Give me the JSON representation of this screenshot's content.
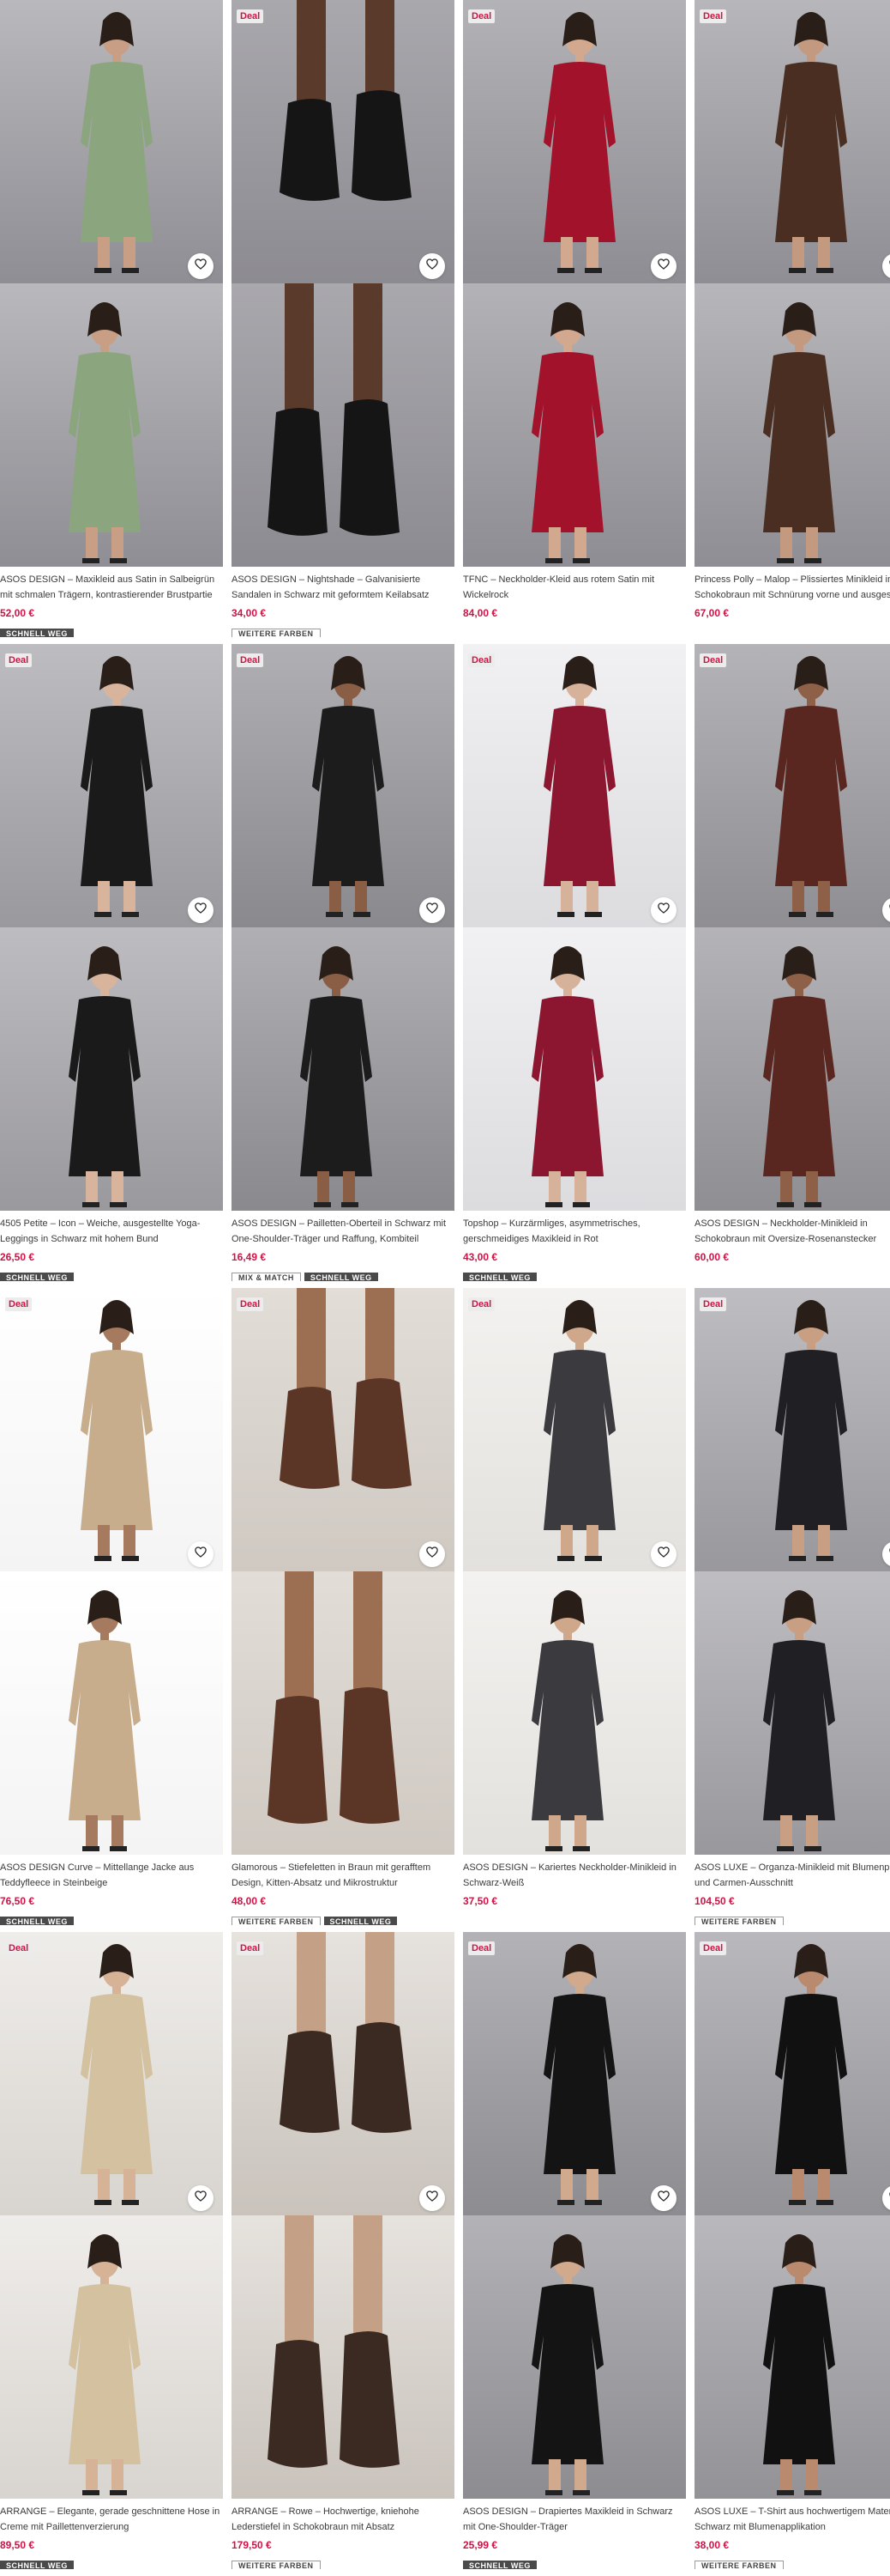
{
  "products": [
    {
      "deal": "",
      "bg": [
        "#b9b8bc",
        "#8f8e94"
      ],
      "garment": "#8ba67e",
      "skin": "#c89f84",
      "title_lines": [
        "ASOS DESIGN – Maxikleid aus Satin in Salbeigrün",
        "mit schmalen Trägern, kontrastierender Brustpartie"
      ],
      "price": "52,00 €",
      "chips": [
        {
          "label": "SCHNELL WEG",
          "style": "dark"
        }
      ]
    },
    {
      "deal": "Deal",
      "bg": [
        "#a9a8ad",
        "#8c8b91"
      ],
      "garment": "#151515",
      "skin": "#5a3a2a",
      "title_lines": [
        "ASOS DESIGN – Nightshade – Galvanisierte",
        "Sandalen in Schwarz mit geformtem Keilabsatz"
      ],
      "price": "34,00 €",
      "chips": [
        {
          "label": "WEITERE FARBEN",
          "style": "light"
        }
      ]
    },
    {
      "deal": "Deal",
      "bg": [
        "#b3b2b6",
        "#8e8d93"
      ],
      "garment": "#a3122b",
      "skin": "#d2a98f",
      "title_lines": [
        "TFNC – Neckholder-Kleid aus rotem Satin mit",
        "Wickelrock"
      ],
      "price": "84,00 €",
      "chips": []
    },
    {
      "deal": "Deal",
      "bg": [
        "#b7b6ba",
        "#8f8e94"
      ],
      "garment": "#4a2e22",
      "skin": "#c39a80",
      "title_lines": [
        "Princess Polly – Malop – Plissiertes Minikleid in",
        "Schokobraun mit Schnürung vorne und ausgest"
      ],
      "price": "67,00 €",
      "chips": []
    },
    {
      "deal": "Deal",
      "bg": [
        "#bdbcc0",
        "#9a999e"
      ],
      "garment": "#1a1a1a",
      "skin": "#d8b49c",
      "title_lines": [
        "4505 Petite – Icon – Weiche, ausgestellte Yoga-",
        "Leggings in Schwarz mit hohem Bund"
      ],
      "price": "26,50 €",
      "chips": [
        {
          "label": "SCHNELL WEG",
          "style": "dark"
        }
      ]
    },
    {
      "deal": "Deal",
      "bg": [
        "#b0afb3",
        "#8a898e"
      ],
      "garment": "#1c1c1c",
      "skin": "#8a5e45",
      "title_lines": [
        "ASOS DESIGN – Pailletten-Oberteil in Schwarz mit",
        "One-Shoulder-Träger und Raffung, Kombiteil"
      ],
      "price": "16,49 €",
      "chips": [
        {
          "label": "MIX & MATCH",
          "style": "light"
        },
        {
          "label": "SCHNELL WEG",
          "style": "dark"
        }
      ]
    },
    {
      "deal": "Deal",
      "bg": [
        "#f1f1f3",
        "#dcdcdf"
      ],
      "garment": "#8c1530",
      "skin": "#d6b29a",
      "title_lines": [
        "Topshop – Kurzärmliges, asymmetrisches,",
        "gerschmeidiges Maxikleid in Rot"
      ],
      "price": "43,00 €",
      "chips": [
        {
          "label": "SCHNELL WEG",
          "style": "dark"
        }
      ]
    },
    {
      "deal": "Deal",
      "bg": [
        "#b4b3b7",
        "#8f8e93"
      ],
      "garment": "#5a2620",
      "skin": "#8f6048",
      "title_lines": [
        "ASOS DESIGN – Neckholder-Minikleid in",
        "Schokobraun mit Oversize-Rosenanstecker"
      ],
      "price": "60,00 €",
      "chips": []
    },
    {
      "deal": "Deal",
      "bg": [
        "#ffffff",
        "#f4f4f4"
      ],
      "garment": "#c7ad8c",
      "skin": "#a57a5e",
      "title_lines": [
        "ASOS DESIGN Curve – Mittellange Jacke aus",
        "Teddyfleece in Steinbeige"
      ],
      "price": "76,50 €",
      "chips": [
        {
          "label": "SCHNELL WEG",
          "style": "dark"
        }
      ]
    },
    {
      "deal": "Deal",
      "bg": [
        "#e2ddd7",
        "#cfc9c2"
      ],
      "garment": "#5b3526",
      "skin": "#9c6f52",
      "title_lines": [
        "Glamorous – Stiefeletten in Braun mit gerafftem",
        "Design, Kitten-Absatz und Mikrostruktur"
      ],
      "price": "48,00 €",
      "chips": [
        {
          "label": "WEITERE FARBEN",
          "style": "light"
        },
        {
          "label": "SCHNELL WEG",
          "style": "dark"
        }
      ]
    },
    {
      "deal": "Deal",
      "bg": [
        "#f3f2f0",
        "#e3e1dd"
      ],
      "garment": "#3b3a3f",
      "skin": "#cfa78a",
      "title_lines": [
        "ASOS DESIGN – Kariertes Neckholder-Minikleid in",
        "Schwarz-Weiß"
      ],
      "price": "37,50 €",
      "chips": []
    },
    {
      "deal": "Deal",
      "bg": [
        "#bebdc1",
        "#99989d"
      ],
      "garment": "#1f1f24",
      "skin": "#c89f82",
      "title_lines": [
        "ASOS LUXE – Organza-Minikleid mit Blumenpr",
        "und Carmen-Ausschnitt"
      ],
      "price": "104,50 €",
      "chips": [
        {
          "label": "WEITERE FARBEN",
          "style": "light"
        }
      ]
    },
    {
      "deal": "Deal",
      "bg": [
        "#efedea",
        "#d8d4cf"
      ],
      "garment": "#d3c1a0",
      "skin": "#d6b297",
      "title_lines": [
        "ARRANGE – Elegante, gerade geschnittene Hose in",
        "Creme mit Paillettenverzierung"
      ],
      "price": "89,50 €",
      "chips": [
        {
          "label": "SCHNELL WEG",
          "style": "dark"
        }
      ]
    },
    {
      "deal": "Deal",
      "bg": [
        "#e6e2dd",
        "#c9c3bc"
      ],
      "garment": "#3a2a22",
      "skin": "#c4a087",
      "title_lines": [
        "ARRANGE – Rowe – Hochwertige, kniehohe",
        "Lederstiefel in Schokobraun mit Absatz"
      ],
      "price": "179,50 €",
      "chips": [
        {
          "label": "WEITERE FARBEN",
          "style": "light"
        }
      ]
    },
    {
      "deal": "Deal",
      "bg": [
        "#b3b2b6",
        "#8d8c91"
      ],
      "garment": "#141414",
      "skin": "#d1a98d",
      "title_lines": [
        "ASOS DESIGN – Drapiertes Maxikleid in Schwarz",
        "mit One-Shoulder-Träger"
      ],
      "price": "25,99 €",
      "chips": [
        {
          "label": "SCHNELL WEG",
          "style": "dark"
        }
      ]
    },
    {
      "deal": "Deal",
      "bg": [
        "#b9b8bc",
        "#939297"
      ],
      "garment": "#111111",
      "skin": "#b98a6d",
      "title_lines": [
        "ASOS LUXE – T-Shirt aus hochwertigem Mater",
        "Schwarz mit Blumenapplikation"
      ],
      "price": "38,00 €",
      "chips": [
        {
          "label": "WEITERE FARBEN",
          "style": "light"
        }
      ]
    }
  ],
  "colors": {
    "price": "#d01345",
    "deal_text": "#d01345",
    "chip_dark": "#4a4a4a"
  },
  "icons": {
    "wishlist": "heart-icon"
  }
}
